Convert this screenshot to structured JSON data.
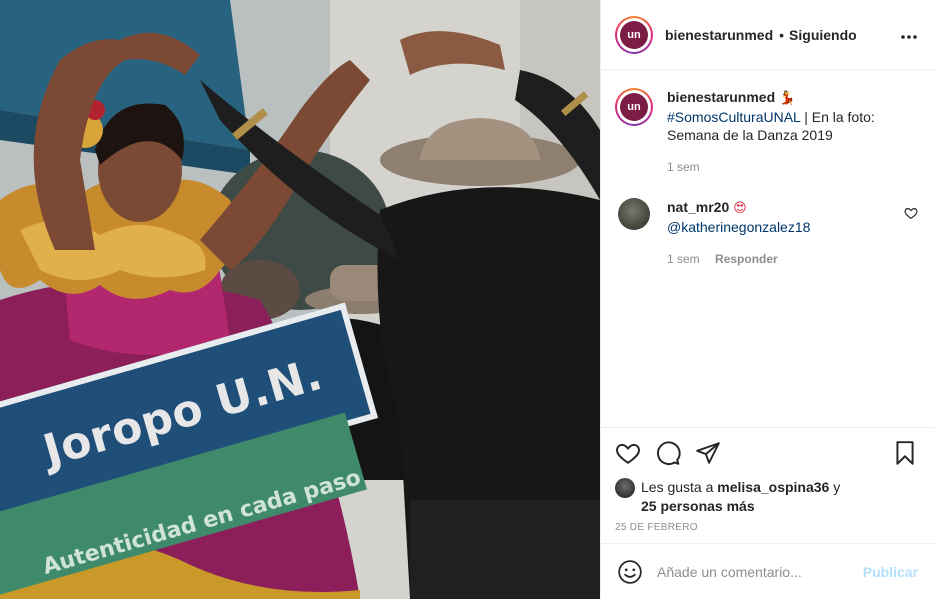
{
  "photo": {
    "banner_title": "Joropo U.N.",
    "banner_subtitle": "Autenticidad en cada paso"
  },
  "header": {
    "avatar_text": "un",
    "username": "bienestarunmed",
    "separator": "•",
    "follow_status": "Siguiendo",
    "more_icon": "more-horizontal-icon"
  },
  "caption": {
    "avatar_text": "un",
    "username": "bienestarunmed",
    "emoji": "💃",
    "hashtag": "#SomosCulturaUNAL",
    "text": " | En la foto: Semana de la Danza 2019",
    "time": "1 sem"
  },
  "comments": [
    {
      "username": "nat_mr20",
      "emoji": "😍",
      "mention": "@katherinegonzalez18",
      "time": "1 sem",
      "reply_label": "Responder"
    }
  ],
  "actions": {
    "icons": [
      "heart-icon",
      "comment-icon",
      "share-icon",
      "bookmark-icon"
    ],
    "likes_prefix": "Les gusta a ",
    "liker": "melisa_ospina36",
    "likes_mid": " y",
    "likes_others": "25 personas más",
    "date": "25 DE FEBRERO"
  },
  "add_comment": {
    "placeholder": "Añade un comentario...",
    "publish_label": "Publicar"
  },
  "colors": {
    "link": "#00376b",
    "muted": "#8e8e8e",
    "publish_disabled": "#b2dffc",
    "banner_blue": "#1f4e79",
    "banner_green": "#3f8a6a"
  }
}
